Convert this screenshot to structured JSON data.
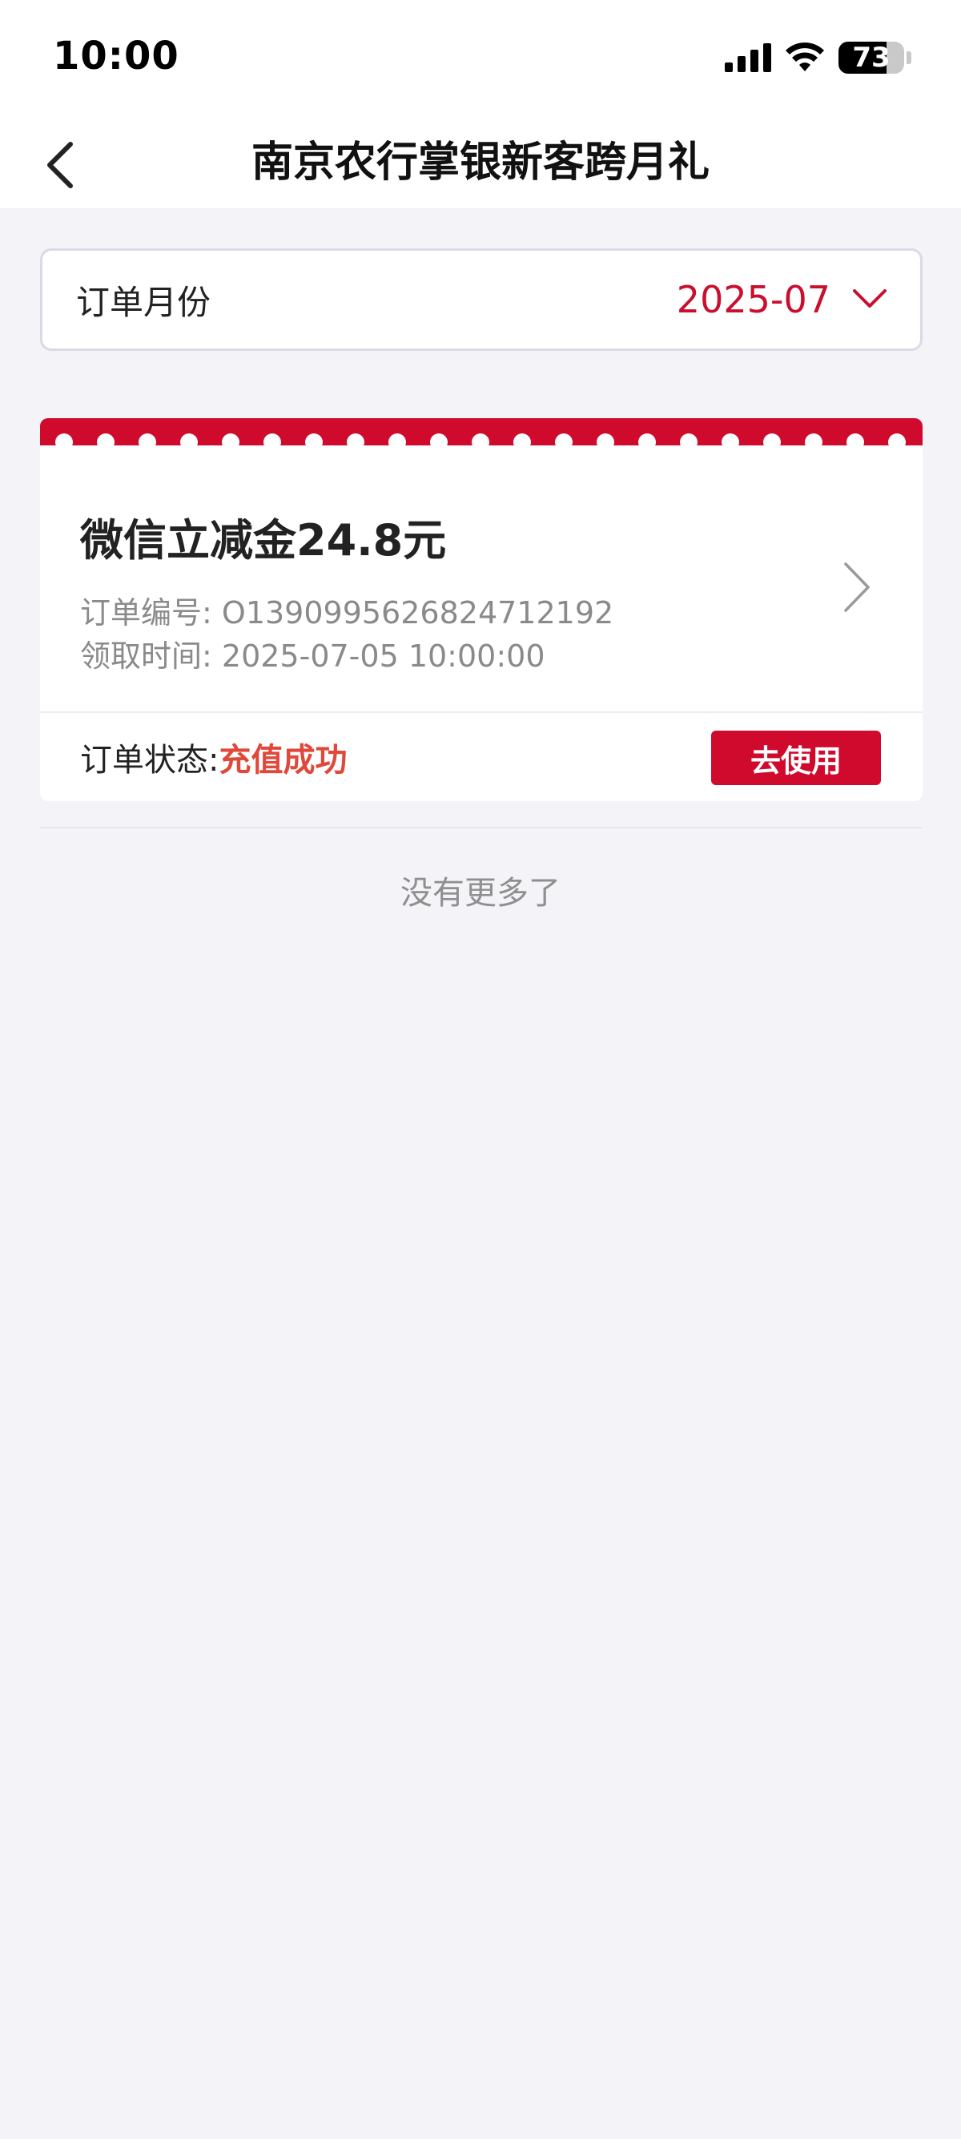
{
  "status_bar": {
    "time": "10:00",
    "battery_level": "73",
    "battery_fraction": 0.73
  },
  "header": {
    "title": "南京农行掌银新客跨月礼",
    "back_icon": "chevron-left-icon"
  },
  "month_filter": {
    "label": "订单月份",
    "value": "2025-07",
    "icon": "chevron-down-icon"
  },
  "orders": [
    {
      "title": "微信立减金24.8元",
      "number_label": "订单编号:",
      "number": "O1390995626824712192",
      "time_label": "领取时间:",
      "time": "2025-07-05 10:00:00",
      "status_label": "订单状态:",
      "status": "充值成功",
      "action_label": "去使用"
    }
  ],
  "list_end": {
    "text": "没有更多了"
  },
  "colors": {
    "brand_red": "#cf0a2c",
    "status_orange_red": "#e0483a",
    "month_red": "#c8102e",
    "background": "#f3f3f8"
  }
}
